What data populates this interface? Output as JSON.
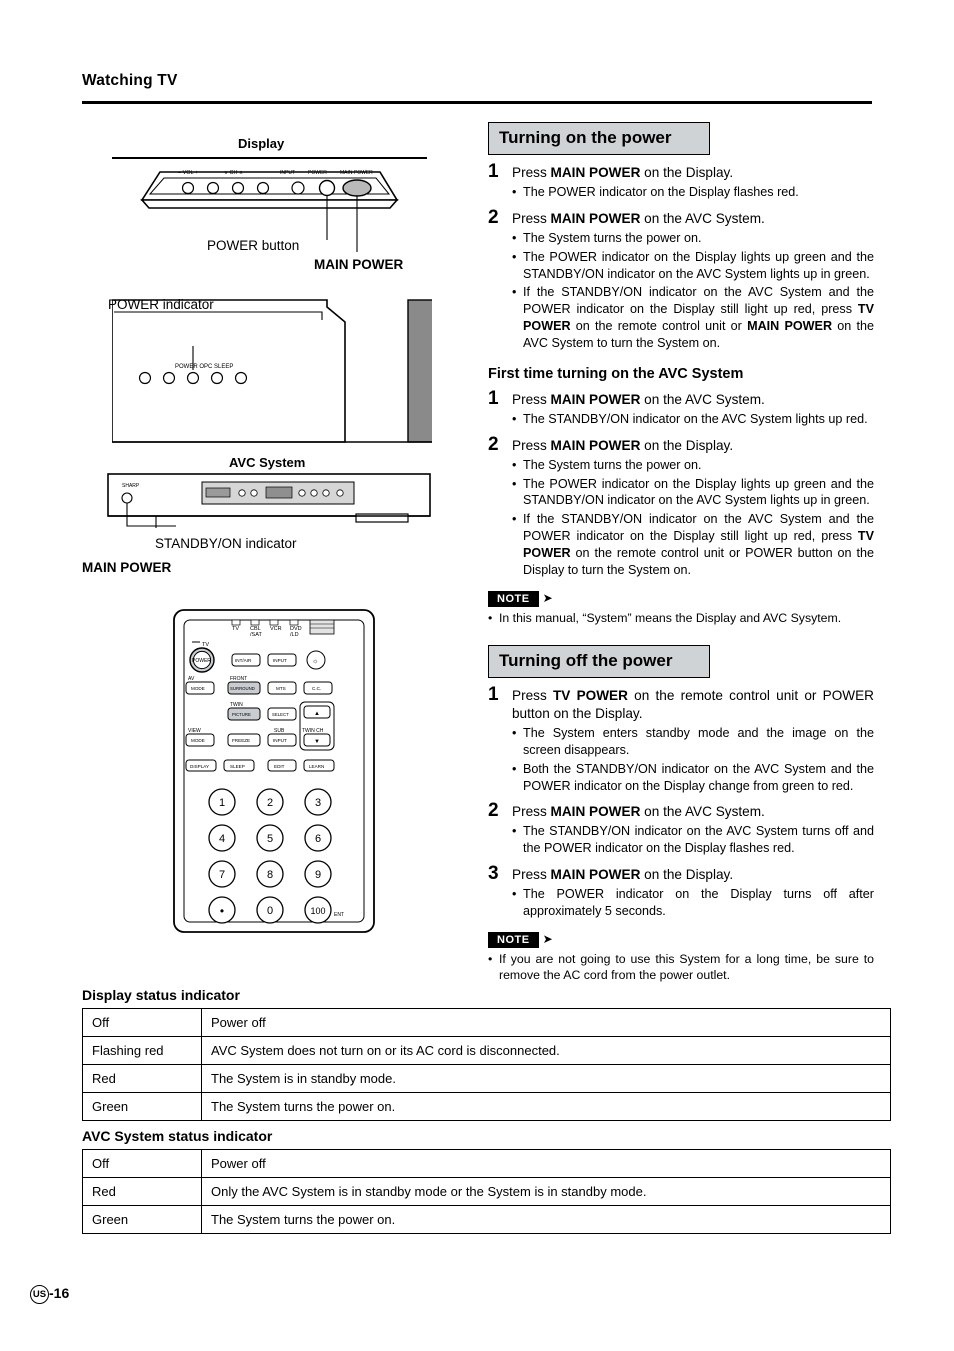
{
  "header": {
    "title": "Watching TV"
  },
  "left": {
    "display_label": "Display",
    "power_button_label": "POWER button",
    "main_power_label_1": "MAIN POWER",
    "power_indicator_label": "POWER indicator",
    "avc_system_label": "AVC System",
    "standby_on_label": "STANDBY/ON  indicator",
    "main_power_label_2": "MAIN POWER",
    "display_panel": {
      "vol_minus": "– VOL +",
      "ch": "∨ CH ∧",
      "input": "INPUT",
      "power": "POWER",
      "main_power": "MAIN POWER",
      "indicators": "POWER OPC SLEEP"
    },
    "avc_panel": {
      "brand": "SHARP"
    },
    "remote": {
      "top_row": [
        "TV",
        "CBL\n/SAT",
        "VCR",
        "DVD\n/LD"
      ],
      "tv": "TV",
      "power": "POWER",
      "int_air": "INT/AIR",
      "input": "INPUT",
      "av_mode": "MODE",
      "av": "AV",
      "front": "FRONT",
      "front_surr": "SURROUND",
      "mts": "MTS",
      "cc": "C.C.",
      "twin": "TWIN",
      "picture": "PICTURE",
      "select": "SELECT",
      "view": "VIEW",
      "view_mode": "MODE",
      "freeze": "FREEZE",
      "sub": "SUB",
      "sub_input": "INPUT",
      "twin_ch": "TWIN CH",
      "display": "DISPLAY",
      "sleep": "SLEEP",
      "edit": "EDIT",
      "learn": "LEARN",
      "keys": [
        "1",
        "2",
        "3",
        "4",
        "5",
        "6",
        "7",
        "8",
        "9",
        "•",
        "0",
        "100"
      ],
      "ent": "ENT"
    }
  },
  "sections": {
    "turning_on": {
      "heading": "Turning on the power",
      "steps": [
        {
          "num": "1",
          "text_pre": "Press ",
          "text_bold": "MAIN POWER",
          "text_post": " on the Display.",
          "bullets": [
            "The POWER indicator on the Display flashes red."
          ]
        },
        {
          "num": "2",
          "text_pre": "Press ",
          "text_bold": "MAIN POWER",
          "text_post": " on the AVC System.",
          "bullets": [
            "The System turns the power on.",
            "The POWER indicator on the Display lights up green and the STANDBY/ON indicator on the AVC System lights up in green."
          ],
          "bullet_rich": "If the STANDBY/ON indicator on the AVC System and the POWER indicator on the Display still light up red, press TV POWER on the remote control unit or MAIN POWER on the AVC System to turn the System on."
        }
      ],
      "subhead": "First time turning on the AVC System",
      "sub_steps": [
        {
          "num": "1",
          "text_pre": "Press ",
          "text_bold": "MAIN POWER",
          "text_post": " on the AVC System.",
          "bullets": [
            "The STANDBY/ON indicator on the AVC System lights up red."
          ]
        },
        {
          "num": "2",
          "text_pre": "Press ",
          "text_bold": "MAIN POWER",
          "text_post": " on the Display.",
          "bullets": [
            "The System turns the power on.",
            "The POWER indicator on the Display lights up green and the STANDBY/ON indicator on the AVC System lights up in green."
          ],
          "bullet_rich": "If the STANDBY/ON indicator on the AVC System and the POWER indicator on the Display still light up red, press TV POWER on the remote control unit or POWER button on the Display to turn the System on."
        }
      ],
      "note_label": "NOTE",
      "note_text": "In this manual, “System” means the Display and AVC Sysytem."
    },
    "turning_off": {
      "heading": "Turning off the power",
      "steps": [
        {
          "num": "1",
          "text_pre": "Press ",
          "text_bold": "TV POWER",
          "text_post": " on the remote control unit or POWER button on the Display.",
          "bullets": [
            "The System enters standby mode and the image on the screen disappears.",
            "Both the STANDBY/ON indicator on the AVC System and the POWER indicator on the Display change from green to red."
          ]
        },
        {
          "num": "2",
          "text_pre": "Press ",
          "text_bold": "MAIN POWER",
          "text_post": " on the AVC System.",
          "bullets": [
            "The STANDBY/ON indicator on the AVC System turns off and the POWER indicator on the Display flashes red."
          ]
        },
        {
          "num": "3",
          "text_pre": "Press ",
          "text_bold": "MAIN POWER",
          "text_post": " on the Display.",
          "bullets": [
            "The POWER indicator on the Display turns off after approximately 5 seconds."
          ]
        }
      ],
      "note_label": "NOTE",
      "note_text": "If you are not going to use this System for a long time, be sure to remove the AC cord from the power outlet."
    }
  },
  "tables": {
    "display_status": {
      "title": "Display status indicator",
      "rows": [
        {
          "state": "Off",
          "desc": "Power off"
        },
        {
          "state": "Flashing red",
          "desc": "AVC System does not turn on or its AC cord is disconnected."
        },
        {
          "state": "Red",
          "desc": "The System is in standby mode."
        },
        {
          "state": "Green",
          "desc": "The System turns the power on."
        }
      ]
    },
    "avc_status": {
      "title": "AVC System status indicator",
      "rows": [
        {
          "state": "Off",
          "desc": "Power off"
        },
        {
          "state": "Red",
          "desc": "Only the AVC System is in standby mode or the System is in standby mode."
        },
        {
          "state": "Green",
          "desc": "The System turns the power on."
        }
      ]
    }
  },
  "footer": {
    "region": "US",
    "page": "-16"
  }
}
